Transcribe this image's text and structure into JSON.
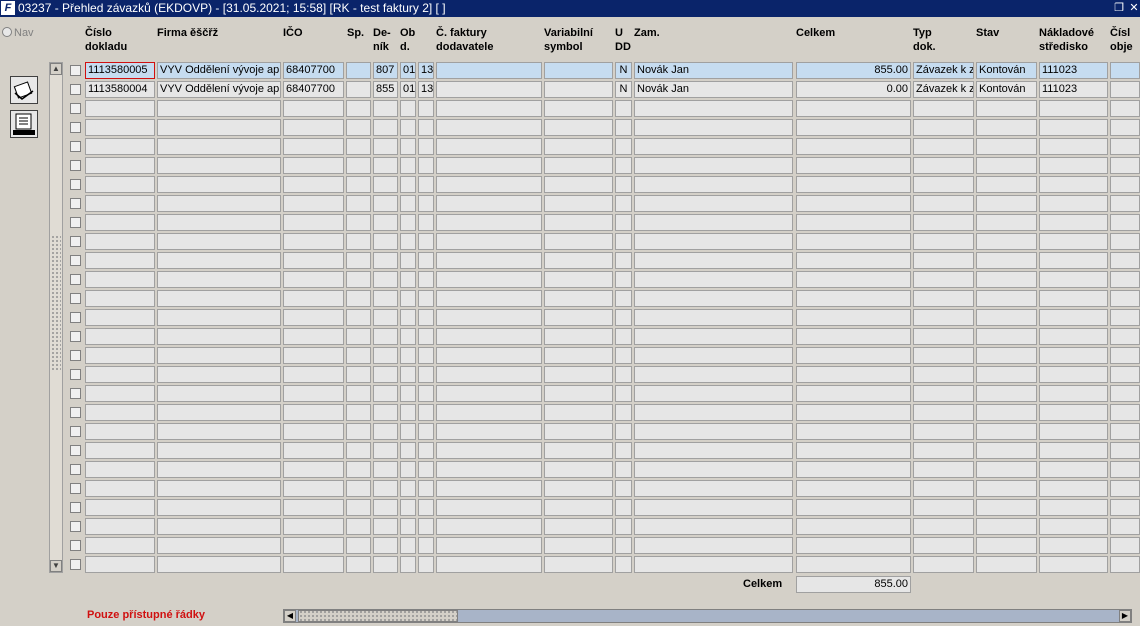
{
  "window": {
    "title": "03237 - Přehled závazků (EKDOVP) - [31.05.2021; 15:58]  [RK - test faktury 2]  [ ]",
    "app_icon_text": "F",
    "restore_icon": "restore-icon",
    "close_icon": "close-icon"
  },
  "left_panel": {
    "nav_label": "Nav"
  },
  "columns": [
    {
      "key": "cislo",
      "label": "Číslo\ndokladu"
    },
    {
      "key": "firma",
      "label": "Firma ěščřž"
    },
    {
      "key": "ico",
      "label": "IČO"
    },
    {
      "key": "sp",
      "label": "Sp."
    },
    {
      "key": "denik",
      "label": "De-\nník"
    },
    {
      "key": "obd",
      "label": "Ob\nd."
    },
    {
      "key": "cf",
      "label": "Č. faktury\ndodavatele"
    },
    {
      "key": "vs",
      "label": "Variabilní\nsymbol"
    },
    {
      "key": "udd",
      "label": "U\nDD"
    },
    {
      "key": "zam",
      "label": "Zam."
    },
    {
      "key": "celkem",
      "label": "Celkem"
    },
    {
      "key": "typ",
      "label": "Typ\ndok."
    },
    {
      "key": "stav",
      "label": "Stav"
    },
    {
      "key": "ns",
      "label": "Nákladové\nstředisko"
    },
    {
      "key": "co",
      "label": "Čísl\nobje"
    }
  ],
  "rows": [
    {
      "cislo": "1113580005",
      "firma": "VYV Oddělení vývoje apl",
      "ico": "68407700",
      "sp": "",
      "denik": "807",
      "obd": "01",
      "x13": "13",
      "cf": "",
      "vs": "",
      "udd": "N",
      "zam": "Novák Jan",
      "celkem": "855.00",
      "typ": "Závazek k z",
      "stav": "Kontován",
      "ns": "111023",
      "co": ""
    },
    {
      "cislo": "1113580004",
      "firma": "VYV Oddělení vývoje apl",
      "ico": "68407700",
      "sp": "",
      "denik": "855",
      "obd": "01",
      "x13": "13",
      "cf": "",
      "vs": "",
      "udd": "N",
      "zam": "Novák Jan",
      "celkem": "0.00",
      "typ": "Závazek k z",
      "stav": "Kontován",
      "ns": "111023",
      "co": ""
    }
  ],
  "total": {
    "label": "Celkem",
    "value": "855.00"
  },
  "footer": {
    "note": "Pouze přístupné řádky"
  }
}
